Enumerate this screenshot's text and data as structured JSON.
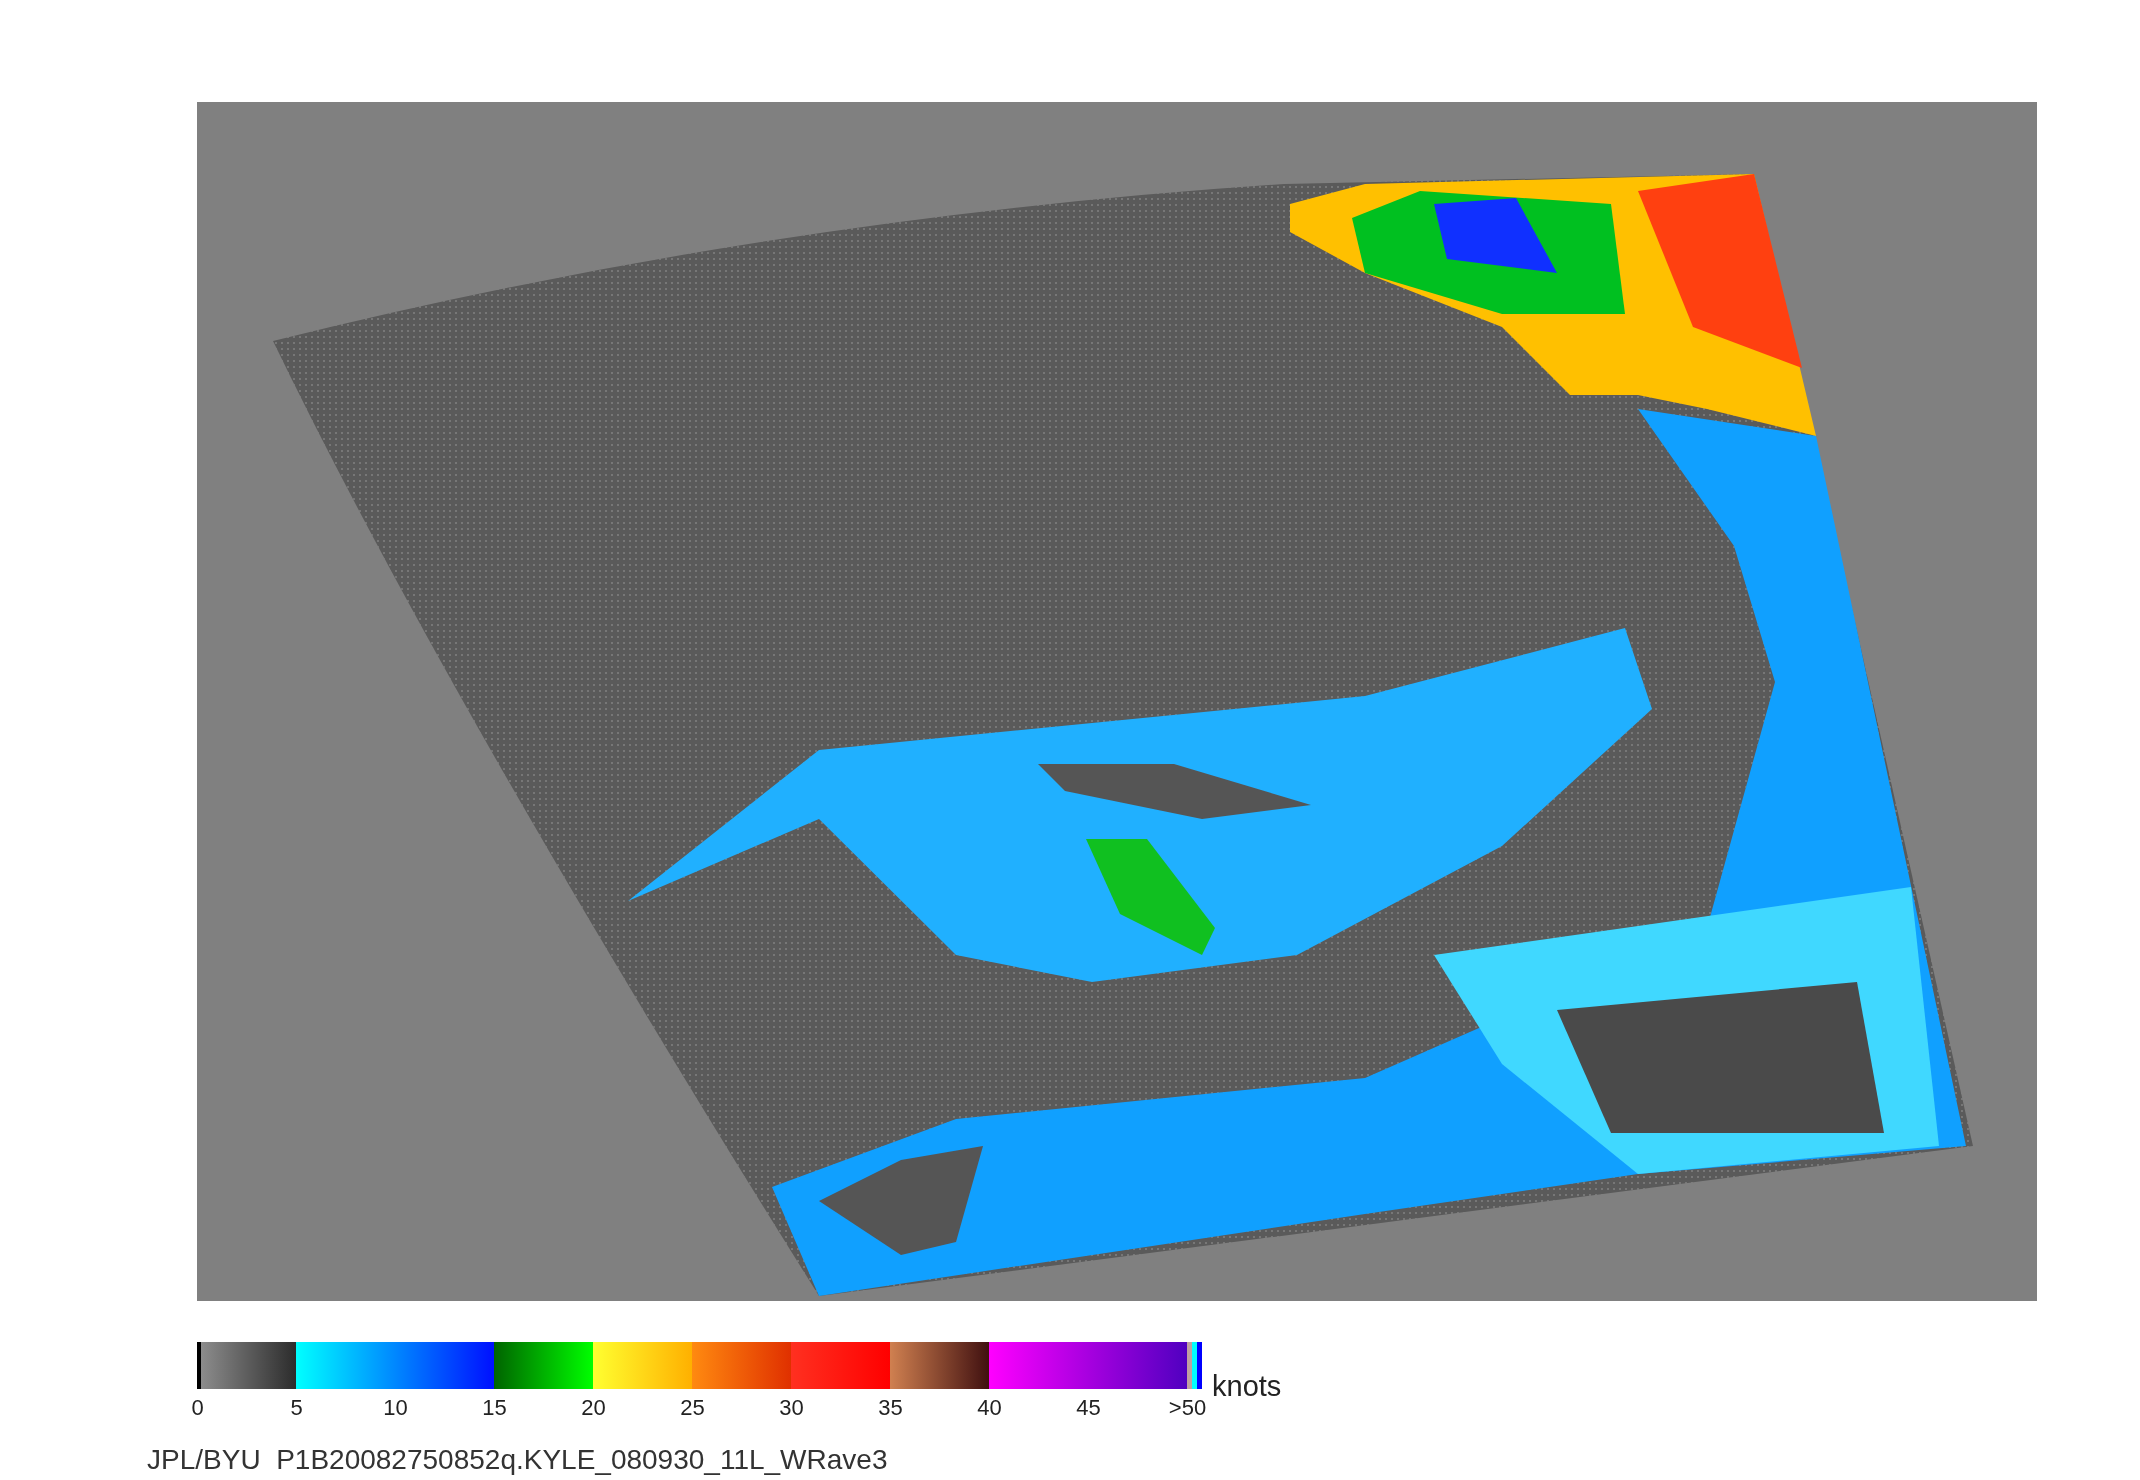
{
  "colorbar": {
    "segments": [
      {
        "color": "#8c8c8c"
      },
      {
        "color": "#00ffff"
      },
      {
        "color": "#006400"
      },
      {
        "color": "#ffff30"
      },
      {
        "color": "#ff8a10"
      },
      {
        "color": "#ff3020"
      },
      {
        "color": "#d08050"
      },
      {
        "color": "#ff00ff"
      }
    ],
    "end_stripes": [
      {
        "color": "#c0a0a0"
      },
      {
        "color": "#00ffff"
      },
      {
        "color": "#0000ff"
      }
    ],
    "ticks": [
      "0",
      "5",
      "10",
      "15",
      "20",
      "25",
      "30",
      "35",
      "40",
      "45",
      ">50"
    ],
    "unit": "knots"
  },
  "caption": "JPL/BYU  P1B20082750852q.KYLE_080930_11L_WRave3"
}
